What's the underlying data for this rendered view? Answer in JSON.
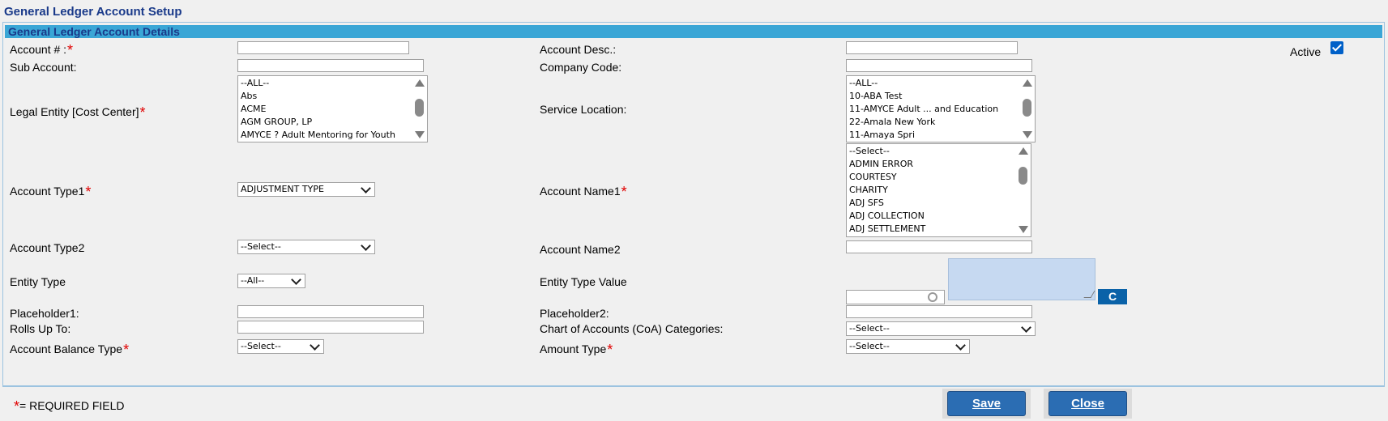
{
  "page": {
    "title": "General Ledger Account Setup",
    "section": "General Ledger Account Details"
  },
  "left": {
    "account_num_label": "Account # :",
    "sub_account_label": "Sub Account:",
    "legal_entity_label": "Legal Entity [Cost Center]",
    "legal_entity_options": [
      "--ALL--",
      "Abs",
      "ACME",
      "AGM GROUP, LP",
      "AMYCE ? Adult Mentoring for Youth"
    ],
    "account_type1_label": "Account Type1",
    "account_type1_value": "ADJUSTMENT TYPE",
    "account_type2_label": "Account Type2",
    "account_type2_value": "--Select--",
    "entity_type_label": "Entity Type",
    "entity_type_value": "--All--",
    "placeholder1_label": "Placeholder1:",
    "rolls_up_label": "Rolls Up To:",
    "balance_type_label": "Account Balance Type",
    "balance_type_value": "--Select--"
  },
  "right": {
    "account_desc_label": "Account Desc.:",
    "company_code_label": "Company Code:",
    "service_location_label": "Service Location:",
    "service_location_options": [
      "--ALL--",
      "10-ABA Test",
      "11-AMYCE Adult ... and Education",
      "22-Amala New York",
      "11-Amaya Spri"
    ],
    "account_name1_label": "Account Name1",
    "account_name1_options": [
      "--Select--",
      "ADMIN ERROR",
      "COURTESY",
      "CHARITY",
      "ADJ SFS",
      "ADJ COLLECTION",
      "ADJ SETTLEMENT"
    ],
    "account_name2_label": "Account Name2",
    "entity_type_value_label": "Entity Type Value",
    "c_button": "C",
    "placeholder2_label": "Placeholder2:",
    "coa_label": "Chart of Accounts (CoA) Categories:",
    "coa_value": "--Select--",
    "amount_type_label": "Amount Type",
    "amount_type_value": "--Select--",
    "active_label": "Active",
    "active_checked": true
  },
  "footer": {
    "required_star": "*",
    "required_text": "= REQUIRED FIELD",
    "save": "Save",
    "close": "Close"
  },
  "colors": {
    "title": "#1a3a8a",
    "section_bar": "#3aa6d6",
    "required": "#e00000",
    "button": "#2b6db3"
  }
}
